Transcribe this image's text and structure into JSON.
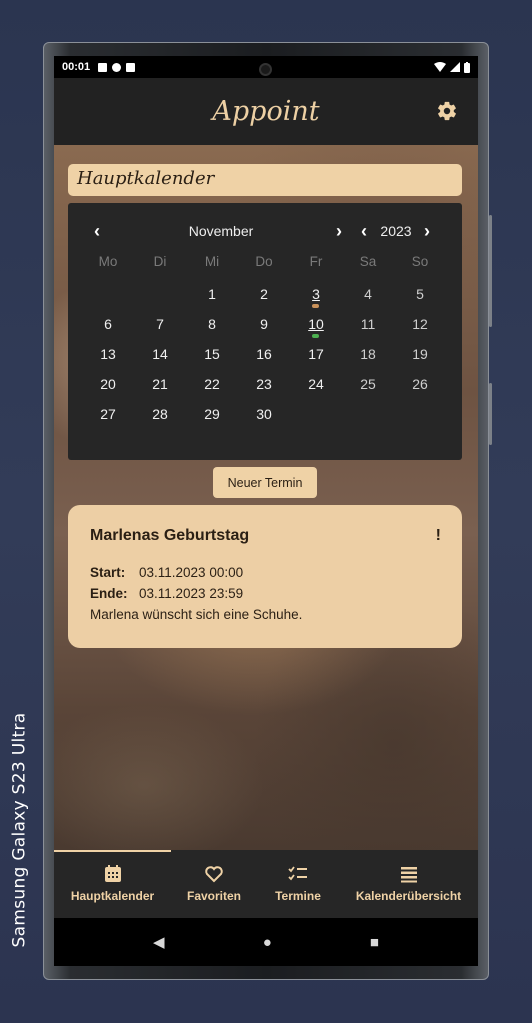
{
  "device": {
    "label": "Samsung Galaxy  S23 Ultra"
  },
  "status_bar": {
    "time": "00:01"
  },
  "app_bar": {
    "title": "Appoint",
    "settings_icon": "gear-icon"
  },
  "calendar_name": "Hauptkalender",
  "calendar": {
    "month": "November",
    "year": "2023",
    "weekdays": [
      "Mo",
      "Di",
      "Mi",
      "Do",
      "Fr",
      "Sa",
      "So"
    ],
    "weeks": [
      [
        "",
        "",
        "1",
        "2",
        "3",
        "4",
        "5"
      ],
      [
        "6",
        "7",
        "8",
        "9",
        "10",
        "11",
        "12"
      ],
      [
        "13",
        "14",
        "15",
        "16",
        "17",
        "18",
        "19"
      ],
      [
        "20",
        "21",
        "22",
        "23",
        "24",
        "25",
        "26"
      ],
      [
        "27",
        "28",
        "29",
        "30",
        "",
        "",
        ""
      ]
    ],
    "markers": {
      "3": "#c8915a",
      "10": "#4caf50"
    },
    "colors": {
      "background": "#262626",
      "weekday": "#7a7a7a",
      "accent": "#efd2a6"
    }
  },
  "new_appointment_label": "Neuer Termin",
  "event": {
    "title": "Marlenas Geburtstag",
    "flag": "!",
    "start_label": "Start:",
    "start_value": "03.11.2023 00:00",
    "end_label": "Ende:",
    "end_value": "03.11.2023 23:59",
    "description": "Marlena wünscht sich eine Schuhe."
  },
  "bottom_nav": {
    "items": [
      {
        "label": "Hauptkalender",
        "icon": "calendar-icon",
        "active": true
      },
      {
        "label": "Favoriten",
        "icon": "heart-icon"
      },
      {
        "label": "Termine",
        "icon": "checklist-icon"
      },
      {
        "label": "Kalenderübersicht",
        "icon": "list-icon"
      }
    ]
  },
  "system_nav": {
    "back": "◀",
    "home": "●",
    "recents": "■"
  }
}
